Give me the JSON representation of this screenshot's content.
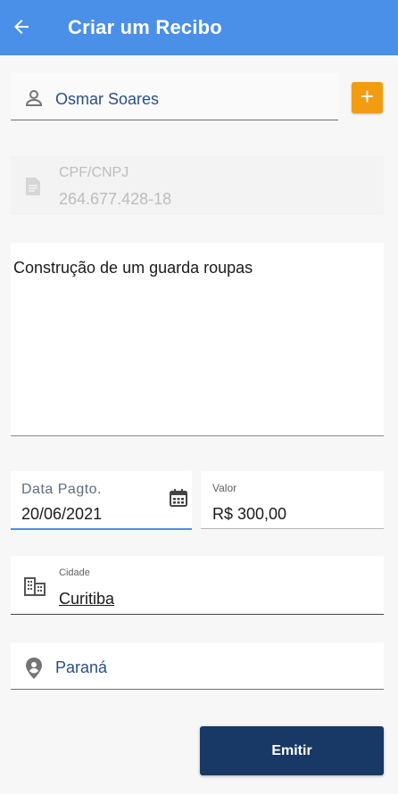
{
  "header": {
    "title": "Criar um Recibo",
    "back_icon": "arrow-left-icon",
    "background": "#4a8fe8"
  },
  "client": {
    "icon": "person-icon",
    "value": "Osmar Soares",
    "add_label": "+",
    "add_color": "#f39c12"
  },
  "document": {
    "icon": "document-icon",
    "label": "CPF/CNPJ",
    "value": "264.677.428-18"
  },
  "description": {
    "value": "Construção de um guarda roupas"
  },
  "payment_date": {
    "label": "Data Pagto.",
    "value": "20/06/2021",
    "icon": "calendar-icon"
  },
  "amount": {
    "label": "Valor",
    "value": "R$ 300,00"
  },
  "city": {
    "label": "Cidade",
    "value": "Curitiba",
    "icon": "building-icon"
  },
  "state": {
    "icon": "location-person-icon",
    "value": "Paraná"
  },
  "actions": {
    "submit_label": "Emitir",
    "submit_color": "#183866"
  }
}
